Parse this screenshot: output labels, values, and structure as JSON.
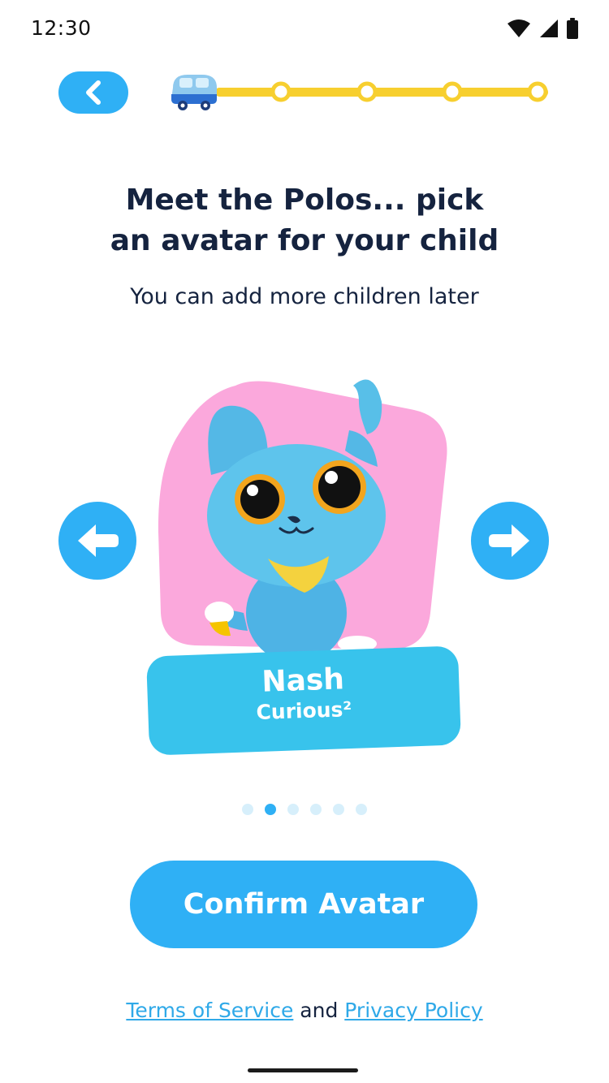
{
  "status_bar": {
    "time": "12:30",
    "icons": [
      "wifi-icon",
      "signal-icon",
      "battery-icon"
    ]
  },
  "header": {
    "back_icon": "chevron-left-icon",
    "progress": {
      "total_steps": 5,
      "current_step": 1,
      "step_icon": "bus-icon"
    }
  },
  "main": {
    "title_line1": "Meet the Polos... pick",
    "title_line2": "an avatar for your child",
    "subtitle": "You can add more children later"
  },
  "avatar": {
    "name": "Nash",
    "trait": "Curious²",
    "prev_icon": "arrow-left-icon",
    "next_icon": "arrow-right-icon",
    "page_count": 6,
    "active_page": 2
  },
  "actions": {
    "confirm_label": "Confirm Avatar"
  },
  "legal": {
    "terms": "Terms of Service",
    "and": " and ",
    "privacy": "Privacy Policy"
  },
  "colors": {
    "primary": "#2fb0f5",
    "card": "#38c3ec",
    "pink": "#fba8dc",
    "track": "#f7cf2f",
    "text": "#15233f"
  }
}
